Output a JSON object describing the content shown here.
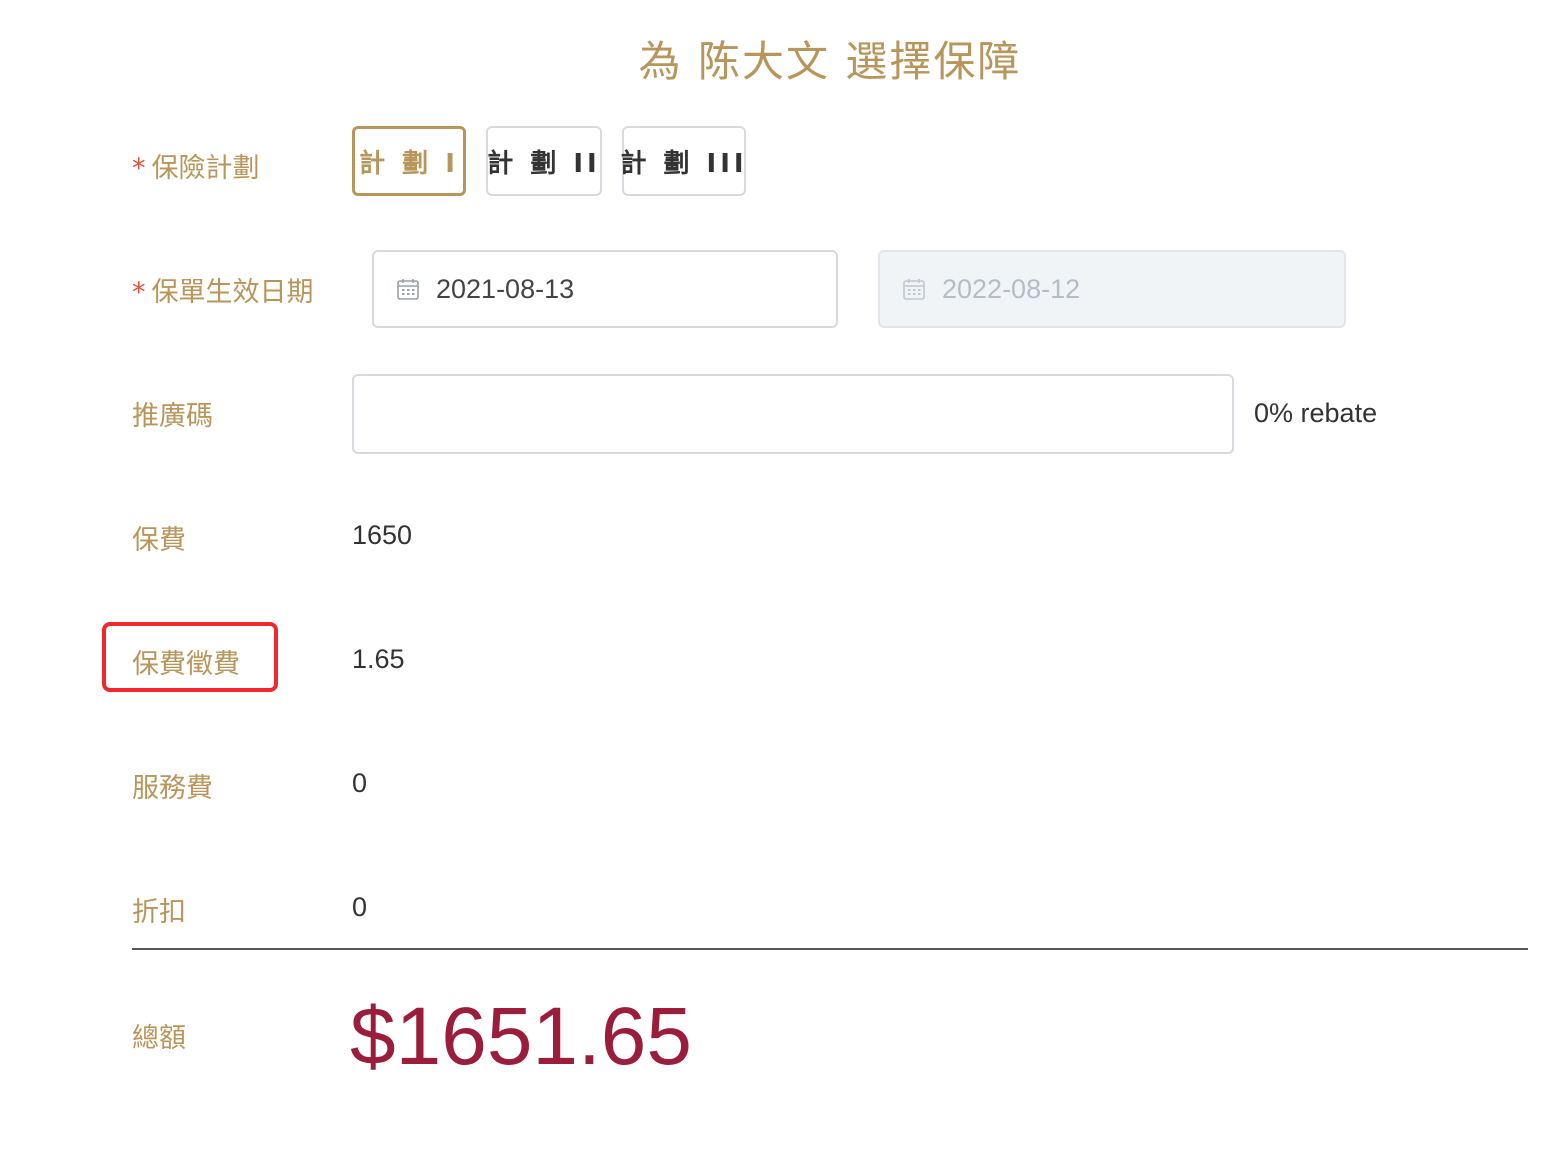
{
  "title": "為 陈大文 選擇保障",
  "plan": {
    "label": "保險計劃",
    "required_mark": "*",
    "options": [
      {
        "label": "計 劃 I",
        "selected": true
      },
      {
        "label": "計 劃 II",
        "selected": false
      },
      {
        "label": "計 劃 III",
        "selected": false
      }
    ]
  },
  "effective_date": {
    "label": "保單生效日期",
    "required_mark": "*",
    "start": "2021-08-13",
    "end": "2022-08-12",
    "end_disabled": true
  },
  "promo": {
    "label": "推廣碼",
    "value": "",
    "placeholder": "",
    "rebate_text": "0% rebate"
  },
  "premium": {
    "label": "保費",
    "value": "1650"
  },
  "levy": {
    "label": "保費徵費",
    "value": "1.65"
  },
  "service_fee": {
    "label": "服務費",
    "value": "0"
  },
  "discount": {
    "label": "折扣",
    "value": "0"
  },
  "total": {
    "label": "總額",
    "value": "$1651.65"
  },
  "colors": {
    "accent": "#b8955a",
    "required": "#e6503c",
    "total": "#9b1d3c",
    "highlight": "#f2262c"
  },
  "icons": {
    "date": "calendar-icon"
  }
}
